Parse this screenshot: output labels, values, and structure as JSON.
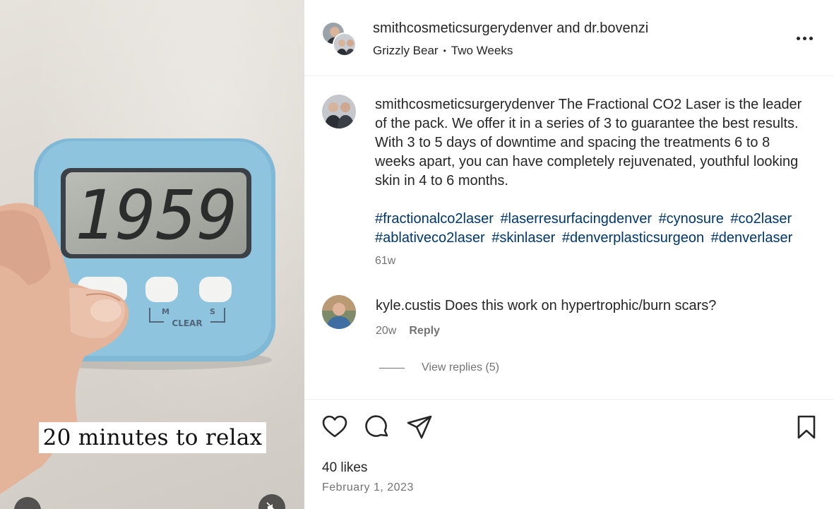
{
  "media": {
    "timer_display": "1959",
    "timer_left_label": "M",
    "timer_right_label": "S",
    "timer_center_label": "CLEAR",
    "caption": "20 minutes to relax"
  },
  "header": {
    "names": "smithcosmeticsurgerydenver and dr.bovenzi",
    "audio_artist": "Grizzly Bear",
    "audio_separator": "•",
    "audio_track": "Two Weeks"
  },
  "caption": {
    "username": "smithcosmeticsurgerydenver",
    "text": "The Fractional CO2 Laser is the leader of the pack. We offer it in a series of 3 to guarantee the best results. With 3 to 5 days of downtime and spacing the treatments 6 to 8 weeks apart, you can have completely rejuvenated, youthful looking skin in 4 to 6 months.",
    "hashtags": [
      "#fractionalco2laser",
      "#laserresurfacingdenver",
      "#cynosure",
      "#co2laser",
      "#ablativeco2laser",
      "#skinlaser",
      "#denverplasticsurgeon",
      "#denverlaser"
    ],
    "time": "61w"
  },
  "comment": {
    "username": "kyle.custis",
    "text": "Does this work on hypertrophic/burn scars?",
    "time": "20w",
    "reply_label": "Reply",
    "view_replies": "View replies (5)"
  },
  "footer": {
    "likes": "40 likes",
    "date": "February 1, 2023"
  },
  "colors": {
    "timer_body": "#8fc4de",
    "hashtag": "#00376b",
    "muted": "#737373"
  },
  "icons": [
    "heart-icon",
    "comment-icon",
    "share-icon",
    "bookmark-icon",
    "more-icon",
    "mute-icon"
  ]
}
